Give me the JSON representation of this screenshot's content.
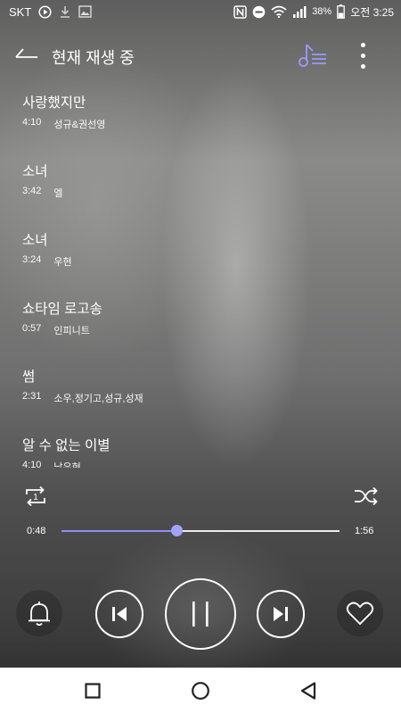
{
  "status_bar": {
    "carrier": "SKT",
    "battery_percent": "38%",
    "time": "오전 3:25",
    "icons": [
      "play-circle-icon",
      "download-icon",
      "image-icon",
      "nfc-icon",
      "do-not-disturb-icon",
      "wifi-icon",
      "signal-icon",
      "battery-icon"
    ]
  },
  "header": {
    "title": "현재 재생 중",
    "back_icon": "back-arrow-icon",
    "queue_icon": "playlist-icon",
    "more_icon": "more-vert-icon"
  },
  "songs": [
    {
      "title": "사랑했지만",
      "duration": "4:10",
      "artist": "성규&권선영"
    },
    {
      "title": "소녀",
      "duration": "3:42",
      "artist": "엘"
    },
    {
      "title": "소녀",
      "duration": "3:24",
      "artist": "우현"
    },
    {
      "title": "쇼타임 로고송",
      "duration": "0:57",
      "artist": "인피니트"
    },
    {
      "title": "썸",
      "duration": "2:31",
      "artist": "소우,정기고,성규,성재"
    },
    {
      "title": "알 수 없는 이별",
      "duration": "4:10",
      "artist": "남우현"
    }
  ],
  "player": {
    "current_time": "0:48",
    "total_time": "1:56",
    "progress_fraction": 0.413,
    "repeat_mode_label": "1",
    "accent_color": "#8f8ff7"
  },
  "nav_bar": {
    "icons": [
      "recents-square-icon",
      "home-circle-icon",
      "back-triangle-icon"
    ]
  }
}
